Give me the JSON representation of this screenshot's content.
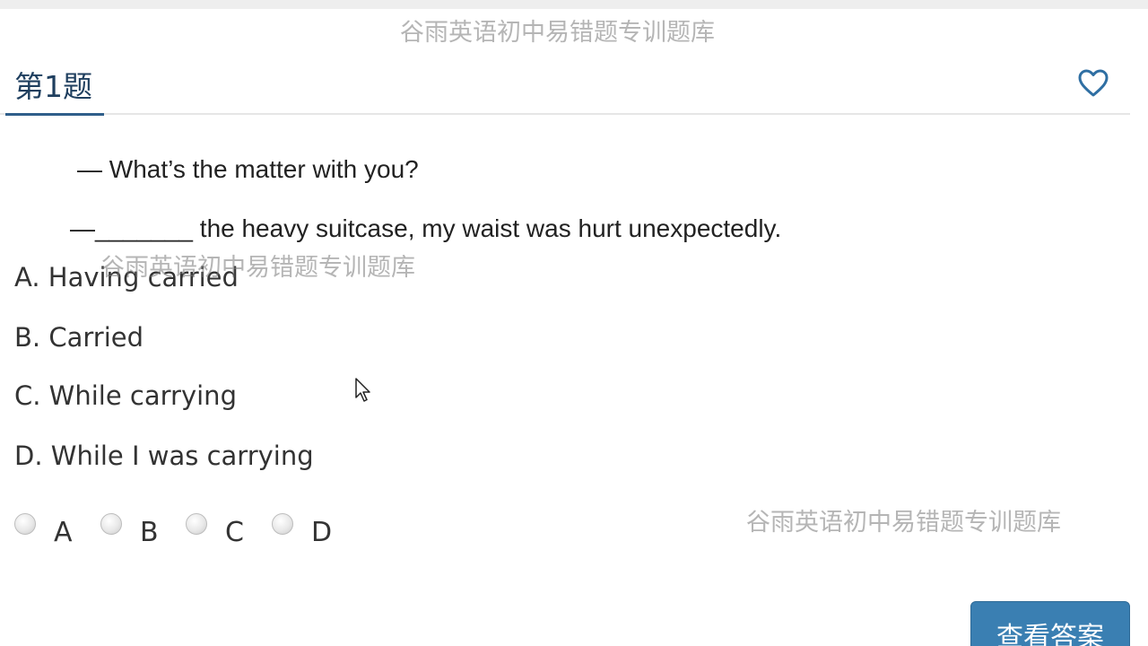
{
  "watermark": "谷雨英语初中易错题专训题库",
  "header": {
    "title": "第1题",
    "favorite_icon": "heart-outline-icon",
    "accent_color": "#2f5f8a"
  },
  "question": {
    "line1": "— What’s the matter with you?",
    "line2": "—_______ the heavy suitcase, my waist was hurt unexpectedly."
  },
  "options": [
    {
      "text": "A. Having carried"
    },
    {
      "text": "B. Carried"
    },
    {
      "text": "C. While carrying"
    },
    {
      "text": "D. While I was carrying"
    }
  ],
  "choices": [
    "A",
    "B",
    "C",
    "D"
  ],
  "answer_button": {
    "label": "查看答案",
    "color": "#3a7fb2"
  }
}
